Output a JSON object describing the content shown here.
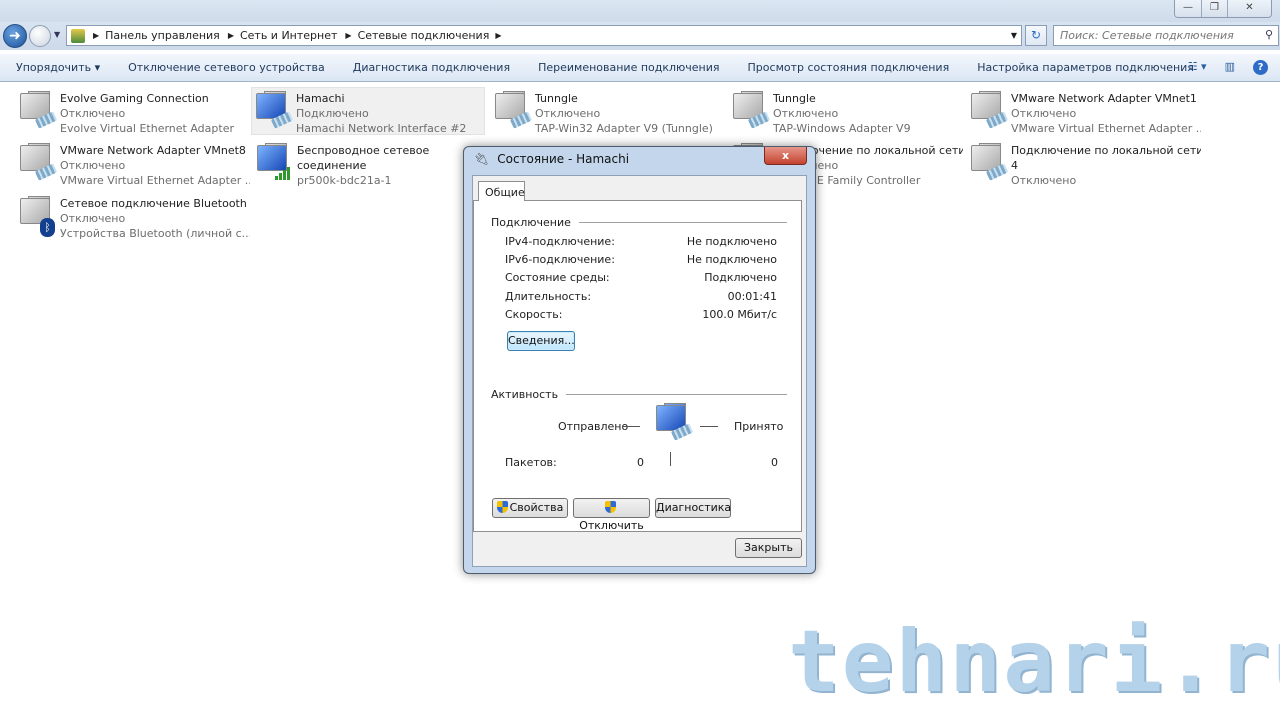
{
  "window": {
    "controls": [
      "—",
      "❐",
      "✕"
    ]
  },
  "nav": {
    "back": "back-button",
    "forward": "forward-button"
  },
  "address": {
    "crumbs": [
      "Панель управления",
      "Сеть и Интернет",
      "Сетевые подключения"
    ]
  },
  "search": {
    "placeholder": "Поиск: Сетевые подключения"
  },
  "toolbar": {
    "items": [
      "Упорядочить ▾",
      "Отключение сетевого устройства",
      "Диагностика подключения",
      "Переименование подключения",
      "Просмотр состояния подключения",
      "Настройка параметров подключения"
    ]
  },
  "connections": [
    {
      "name": "Evolve Gaming Connection",
      "status": "Отключено",
      "device": "Evolve Virtual Ethernet Adapter"
    },
    {
      "name": "Hamachi",
      "status": "Подключено",
      "device": "Hamachi Network Interface #2"
    },
    {
      "name": "Tunngle",
      "status": "Отключено",
      "device": "TAP-Win32 Adapter V9 (Tunngle)"
    },
    {
      "name": "Tunngle",
      "status": "Отключено",
      "device": "TAP-Windows Adapter V9"
    },
    {
      "name": "VMware Network Adapter VMnet1",
      "status": "Отключено",
      "device": "VMware Virtual Ethernet Adapter ..."
    },
    {
      "name": "VMware Network Adapter VMnet8",
      "status": "Отключено",
      "device": "VMware Virtual Ethernet Adapter ..."
    },
    {
      "name": "Беспроводное сетевое",
      "name2": "соединение",
      "device": "pr500k-bdc21a-1"
    },
    {
      "name": "Подключение по локальной сети",
      "status": "Отключено",
      "device": "PCIe GBE Family Controller"
    },
    {
      "name": "Подключение по локальной сети",
      "name2": "4",
      "status": "Отключено"
    },
    {
      "name": "Сетевое подключение Bluetooth",
      "status": "Отключено",
      "device": "Устройства Bluetooth (личной с..."
    }
  ],
  "dialog": {
    "title": "Состояние - Hamachi",
    "tab": "Общие",
    "connection_group": "Подключение",
    "rows": [
      {
        "label": "IPv4-подключение:",
        "value": "Не подключено"
      },
      {
        "label": "IPv6-подключение:",
        "value": "Не подключено"
      },
      {
        "label": "Состояние среды:",
        "value": "Подключено"
      },
      {
        "label": "Длительность:",
        "value": "00:01:41"
      },
      {
        "label": "Скорость:",
        "value": "100.0 Мбит/с"
      }
    ],
    "details_button": "Сведения...",
    "activity_group": "Активность",
    "sent_label": "Отправлено",
    "received_label": "Принято",
    "packets_label": "Пакетов:",
    "packets_sent": "0",
    "packets_received": "0",
    "properties_button": "Свойства",
    "disable_button": "Отключить",
    "diagnose_button": "Диагностика",
    "close_button": "Закрыть"
  },
  "watermark": "tehnari.ru"
}
